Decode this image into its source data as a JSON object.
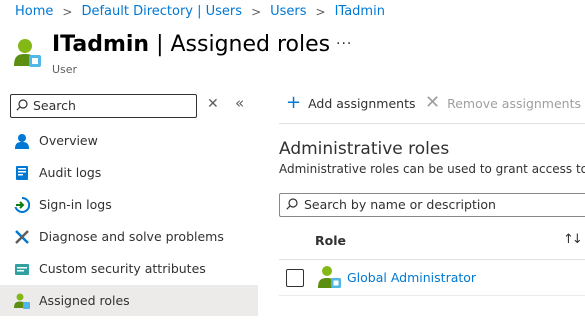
{
  "breadcrumb": [
    "Home",
    "Default Directory | Users",
    "Users",
    "ITadmin"
  ],
  "header": {
    "name": "ITadmin",
    "separator": " | ",
    "title": "Assigned roles",
    "subtitle": "User",
    "more_label": "···"
  },
  "sidebar": {
    "search_placeholder": "Search",
    "items": [
      {
        "label": "Overview",
        "icon": "user-icon",
        "selected": false
      },
      {
        "label": "Audit logs",
        "icon": "audit-log-icon",
        "selected": false
      },
      {
        "label": "Sign-in logs",
        "icon": "sign-in-icon",
        "selected": false
      },
      {
        "label": "Diagnose and solve problems",
        "icon": "wrench-icon",
        "selected": false
      },
      {
        "label": "Custom security attributes",
        "icon": "attributes-icon",
        "selected": false
      },
      {
        "label": "Assigned roles",
        "icon": "assigned-roles-icon",
        "selected": true
      }
    ]
  },
  "toolbar": {
    "add_label": "Add assignments",
    "remove_label": "Remove assignments"
  },
  "main": {
    "section_title": "Administrative roles",
    "section_desc": "Administrative roles can be used to grant access to M",
    "filter_placeholder": "Search by name or description",
    "column_role": "Role",
    "rows": [
      {
        "role": "Global Administrator",
        "icon": "role-user-icon"
      }
    ]
  },
  "colors": {
    "accent": "#0078d4",
    "selected_bg": "#edebe9",
    "disabled": "#a19f9d"
  }
}
